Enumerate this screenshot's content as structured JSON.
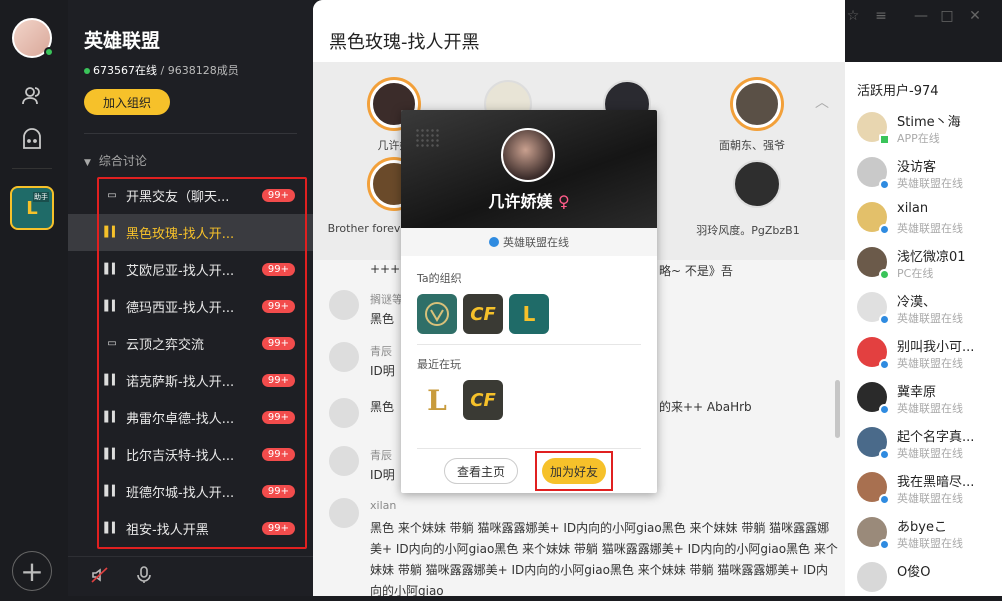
{
  "guild": {
    "title": "英雄联盟",
    "online": "673567在线",
    "members": "9638128成员",
    "join_label": "加入组织",
    "category": "综合讨论",
    "channels": [
      {
        "name": "开黑交友（聊天...",
        "badge": "99+",
        "type": "text"
      },
      {
        "name": "黑色玫瑰-找人开...",
        "badge": "",
        "type": "voice"
      },
      {
        "name": "艾欧尼亚-找人开...",
        "badge": "99+",
        "type": "voice"
      },
      {
        "name": "德玛西亚-找人开...",
        "badge": "99+",
        "type": "voice"
      },
      {
        "name": "云顶之弈交流",
        "badge": "99+",
        "type": "text"
      },
      {
        "name": "诺克萨斯-找人开...",
        "badge": "99+",
        "type": "voice"
      },
      {
        "name": "弗雷尔卓德-找人...",
        "badge": "99+",
        "type": "voice"
      },
      {
        "name": "比尔吉沃特-找人...",
        "badge": "99+",
        "type": "voice"
      },
      {
        "name": "班德尔城-找人开...",
        "badge": "99+",
        "type": "voice"
      },
      {
        "name": "祖安-找人开黑",
        "badge": "99+",
        "type": "voice"
      }
    ]
  },
  "main": {
    "title": "黑色玫瑰-找人开黑",
    "voice_users": [
      {
        "name": "几许妖"
      },
      {
        "name": "面朝东、强爷"
      },
      {
        "name": "Brother forev"
      },
      {
        "name": "羽玲风度。PgZbzB1"
      }
    ],
    "messages": [
      {
        "user": "",
        "text": "++++",
        "tail": "略~ 不是》吾"
      },
      {
        "user": "搁谜等",
        "text": "黑色",
        "tail": ""
      },
      {
        "user": "青辰",
        "text": "ID明",
        "tail": ""
      },
      {
        "user": "",
        "text": "黑色",
        "tail": "的来++ AbaHrb"
      },
      {
        "user": "青辰",
        "text": "ID明",
        "tail": ""
      },
      {
        "user": "xilan",
        "text": "黑色  来个妹妹 带躺  猫咪露露娜美+  ID内向的小阿giao黑色  来个妹妹 带躺  猫咪露露娜美+  ID内向的小阿giao黑色  来个妹妹 带躺  猫咪露露娜美+  ID内向的小阿giao黑色  来个妹妹 带躺  猫咪露露娜美+  ID内向的小阿giao黑色  来个妹妹 带躺  猫咪露露娜美+  ID内向的小阿giao",
        "tail": ""
      }
    ]
  },
  "right": {
    "title": "活跃用户-974",
    "users": [
      {
        "name": "Stime丶海",
        "status": "APP在线"
      },
      {
        "name": "没访客",
        "status": "英雄联盟在线"
      },
      {
        "name": "xilan",
        "status": "英雄联盟在线"
      },
      {
        "name": "浅忆微凉01",
        "status": "PC在线"
      },
      {
        "name": "冷漠、",
        "status": "英雄联盟在线"
      },
      {
        "name": "别叫我小可...",
        "status": "英雄联盟在线"
      },
      {
        "name": "冀幸原",
        "status": "英雄联盟在线"
      },
      {
        "name": "起个名字真...",
        "status": "英雄联盟在线"
      },
      {
        "name": "我在黑暗尽...",
        "status": "英雄联盟在线"
      },
      {
        "name": "あbyeこ",
        "status": "英雄联盟在线"
      },
      {
        "name": "O俊O",
        "status": ""
      }
    ]
  },
  "popup": {
    "name": "几许娇媄",
    "sex_symbol": "♀",
    "status": "英雄联盟在线",
    "orgs_label": "Ta的组织",
    "recent_label": "最近在玩",
    "home_label": "查看主页",
    "add_friend_label": "加为好友",
    "orgs": [
      "LOL",
      "CF",
      "助手"
    ],
    "recent": [
      "LoL",
      "CF"
    ]
  },
  "rail": {
    "game_label": "助手"
  },
  "colors": {
    "accent": "#f6c12a",
    "alert": "#e02020",
    "badge": "#f24c4c"
  }
}
